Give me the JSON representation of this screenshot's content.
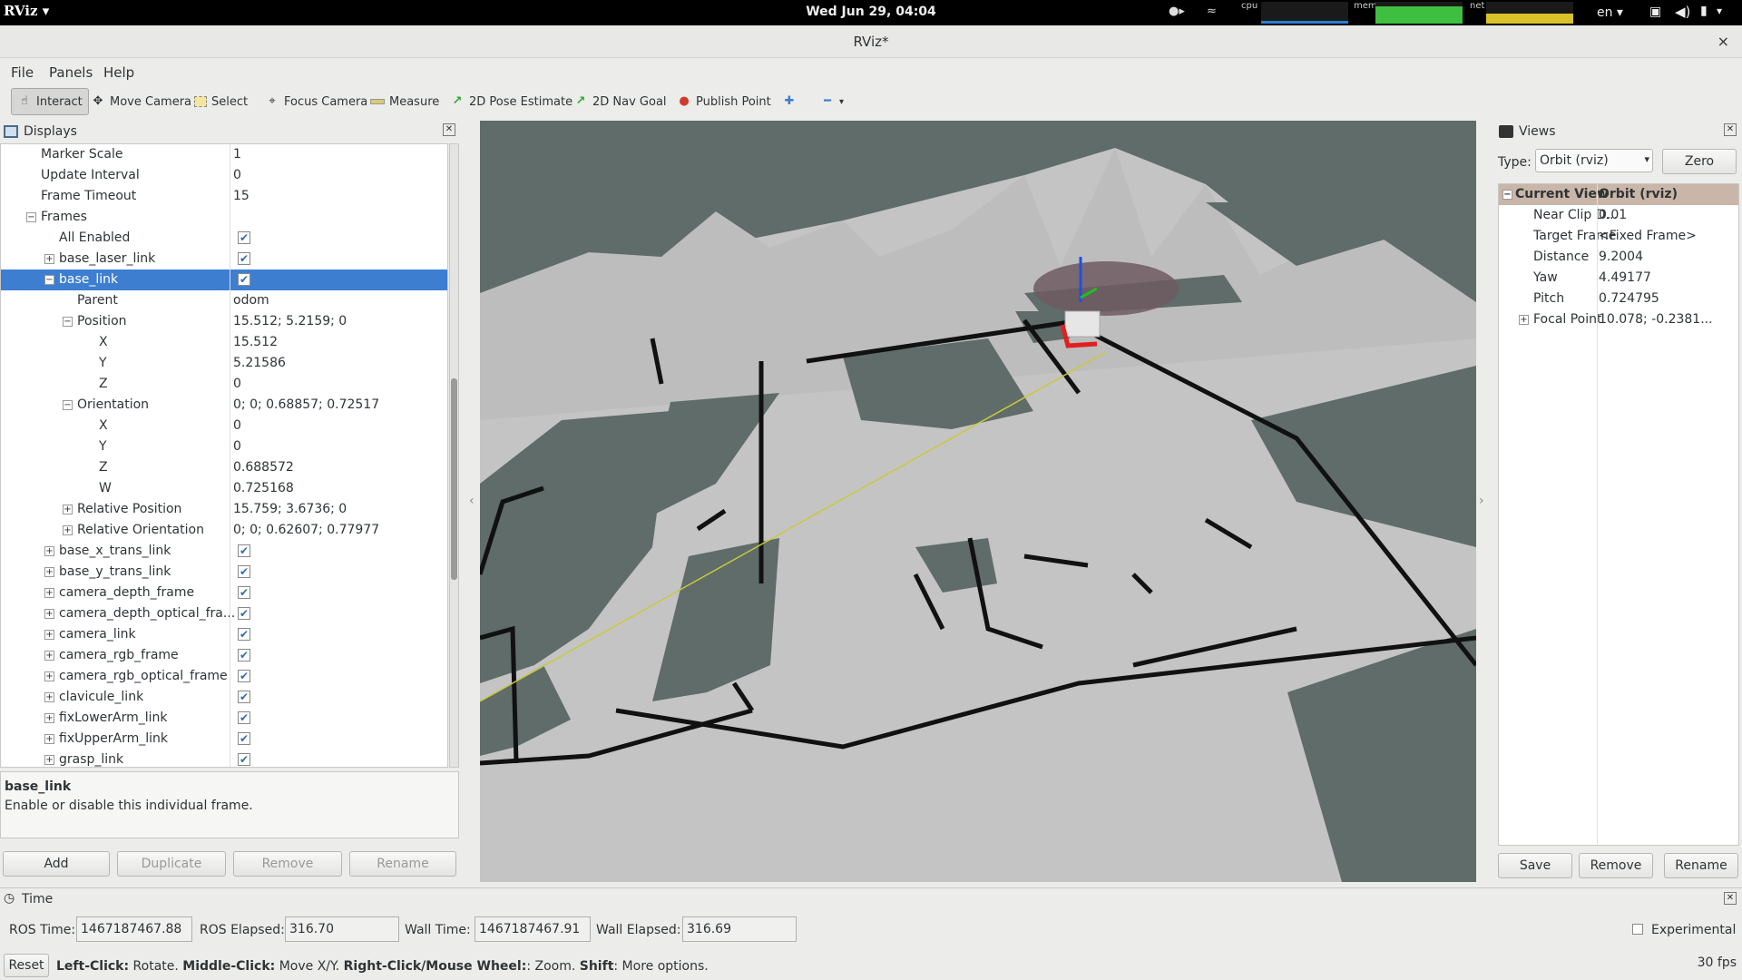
{
  "topbar": {
    "app_menu": "RViz ▾",
    "clock": "Wed Jun 29, 04:04",
    "cpu_label": "cpu",
    "mem_label": "mem",
    "net_label": "net",
    "lang": "en ▾"
  },
  "window": {
    "title": "RViz*",
    "close": "×"
  },
  "menu": {
    "file": "File",
    "panels": "Panels",
    "help": "Help"
  },
  "toolbar": {
    "interact": "Interact",
    "move_camera": "Move Camera",
    "select": "Select",
    "focus_camera": "Focus Camera",
    "measure": "Measure",
    "pose_estimate": "2D Pose Estimate",
    "nav_goal": "2D Nav Goal",
    "publish_point": "Publish Point"
  },
  "displays": {
    "title": "Displays",
    "rows": [
      {
        "name": "Marker Scale",
        "value": "1"
      },
      {
        "name": "Update Interval",
        "value": "0"
      },
      {
        "name": "Frame Timeout",
        "value": "15"
      },
      {
        "name": "Frames",
        "value": ""
      },
      {
        "name": "All Enabled",
        "value": ""
      },
      {
        "name": "base_laser_link",
        "value": ""
      },
      {
        "name": "base_link",
        "value": ""
      },
      {
        "name": "Parent",
        "value": "odom"
      },
      {
        "name": "Position",
        "value": "15.512; 5.2159; 0"
      },
      {
        "name": "X",
        "value": "15.512"
      },
      {
        "name": "Y",
        "value": "5.21586"
      },
      {
        "name": "Z",
        "value": "0"
      },
      {
        "name": "Orientation",
        "value": "0; 0; 0.68857; 0.72517"
      },
      {
        "name": "X",
        "value": "0"
      },
      {
        "name": "Y",
        "value": "0"
      },
      {
        "name": "Z",
        "value": "0.688572"
      },
      {
        "name": "W",
        "value": "0.725168"
      },
      {
        "name": "Relative Position",
        "value": "15.759; 3.6736; 0"
      },
      {
        "name": "Relative Orientation",
        "value": "0; 0; 0.62607; 0.77977"
      },
      {
        "name": "base_x_trans_link",
        "value": ""
      },
      {
        "name": "base_y_trans_link",
        "value": ""
      },
      {
        "name": "camera_depth_frame",
        "value": ""
      },
      {
        "name": "camera_depth_optical_fra...",
        "value": ""
      },
      {
        "name": "camera_link",
        "value": ""
      },
      {
        "name": "camera_rgb_frame",
        "value": ""
      },
      {
        "name": "camera_rgb_optical_frame",
        "value": ""
      },
      {
        "name": "clavicule_link",
        "value": ""
      },
      {
        "name": "fixLowerArm_link",
        "value": ""
      },
      {
        "name": "fixUpperArm_link",
        "value": ""
      },
      {
        "name": "grasp_link",
        "value": ""
      }
    ],
    "description_title": "base_link",
    "description_text": "Enable or disable this individual frame.",
    "add": "Add",
    "duplicate": "Duplicate",
    "remove": "Remove",
    "rename": "Rename"
  },
  "views": {
    "title": "Views",
    "type_label": "Type:",
    "type_value": "Orbit (rviz)",
    "zero": "Zero",
    "header_key": "Current View",
    "header_value": "Orbit (rviz)",
    "rows": [
      {
        "name": "Near Clip D...",
        "value": "0.01"
      },
      {
        "name": "Target Frame",
        "value": "<Fixed Frame>"
      },
      {
        "name": "Distance",
        "value": "9.2004"
      },
      {
        "name": "Yaw",
        "value": "4.49177"
      },
      {
        "name": "Pitch",
        "value": "0.724795"
      },
      {
        "name": "Focal Point",
        "value": "10.078; -0.2381..."
      }
    ],
    "save": "Save",
    "remove": "Remove",
    "rename": "Rename"
  },
  "time": {
    "title": "Time",
    "ros_time_label": "ROS Time:",
    "ros_time": "1467187467.88",
    "ros_elapsed_label": "ROS Elapsed:",
    "ros_elapsed": "316.70",
    "wall_time_label": "Wall Time:",
    "wall_time": "1467187467.91",
    "wall_elapsed_label": "Wall Elapsed:",
    "wall_elapsed": "316.69",
    "experimental": "Experimental",
    "reset": "Reset",
    "hint_left_b": "Left-Click:",
    "hint_left": " Rotate. ",
    "hint_mid_b": "Middle-Click:",
    "hint_mid": " Move X/Y. ",
    "hint_right_b": "Right-Click/Mouse Wheel:",
    "hint_right": ": Zoom. ",
    "hint_shift_b": "Shift",
    "hint_shift": ": More options.",
    "fps": "30 fps"
  },
  "colors": {
    "selection": "#3d7ed1",
    "viewport_bg": "#5f6c69",
    "map_free": "#c2c2c2",
    "header_tan": "#c9b6a8"
  }
}
